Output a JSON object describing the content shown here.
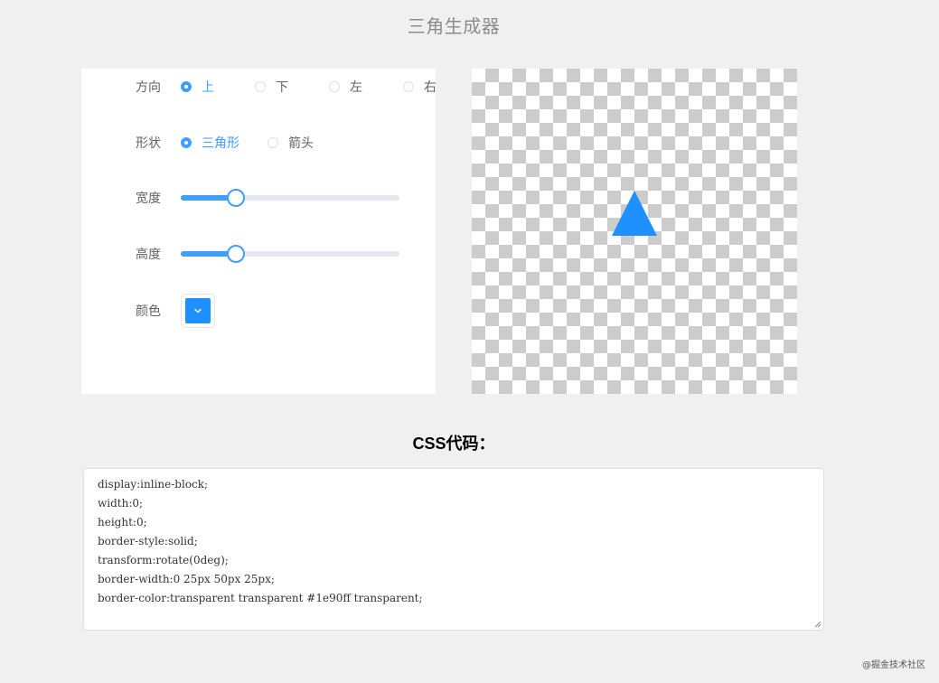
{
  "title": "三角生成器",
  "form": {
    "direction": {
      "label": "方向",
      "options": [
        "上",
        "下",
        "左",
        "右"
      ],
      "selected": "上"
    },
    "shape": {
      "label": "形状",
      "options": [
        "三角形",
        "箭头"
      ],
      "selected": "三角形"
    },
    "width": {
      "label": "宽度",
      "value": 0.25
    },
    "height": {
      "label": "高度",
      "value": 0.25
    },
    "color": {
      "label": "颜色",
      "value": "#1e90ff"
    }
  },
  "preview": {
    "direction": "up",
    "color": "#1e90ff"
  },
  "code": {
    "heading": "CSS代码：",
    "lines": [
      "display:inline-block;",
      "width:0;",
      "height:0;",
      "border-style:solid;",
      "transform:rotate(0deg);",
      "border-width:0 25px 50px 25px;",
      "border-color:transparent transparent #1e90ff transparent;"
    ]
  },
  "watermark": "@掘金技术社区",
  "colors": {
    "accent": "#409eff",
    "background": "#f0f0f0"
  },
  "icons": {
    "color_dropdown": "chevron-down-icon"
  }
}
